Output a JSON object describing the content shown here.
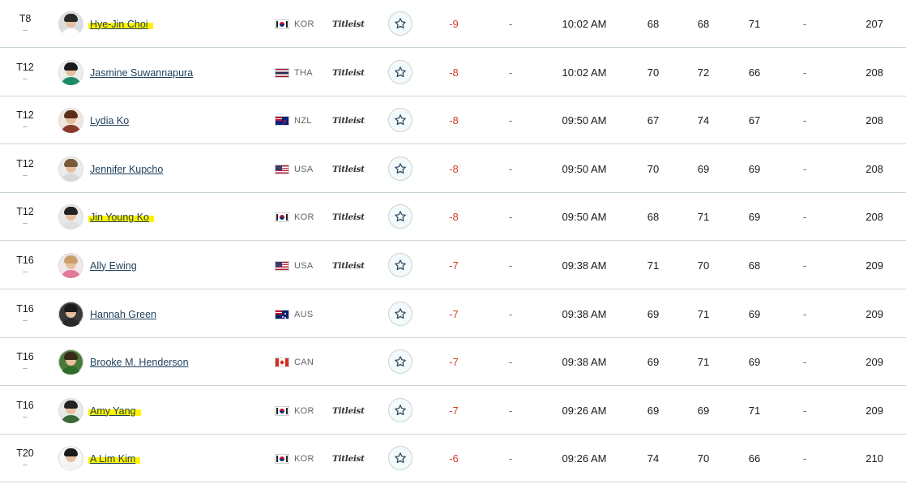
{
  "rows": [
    {
      "pos": "T8",
      "move": "–",
      "name": "Hye-Jin Choi",
      "highlight": true,
      "country": "KOR",
      "sponsor": "Titleist",
      "to_par": "-9",
      "thru": "-",
      "time": "10:02 AM",
      "r1": "68",
      "r2": "68",
      "r3": "71",
      "r4": "-",
      "total": "207",
      "colors": {
        "hair": "#2a2a2a",
        "top": "#ffffff",
        "bg": "#d9dede"
      }
    },
    {
      "pos": "T12",
      "move": "–",
      "name": "Jasmine Suwannapura",
      "highlight": false,
      "country": "THA",
      "sponsor": "Titleist",
      "to_par": "-8",
      "thru": "-",
      "time": "10:02 AM",
      "r1": "70",
      "r2": "72",
      "r3": "66",
      "r4": "-",
      "total": "208",
      "colors": {
        "hair": "#1a1a1a",
        "top": "#1f8a6a",
        "bg": "#e9f0ee"
      }
    },
    {
      "pos": "T12",
      "move": "–",
      "name": "Lydia Ko",
      "highlight": false,
      "country": "NZL",
      "sponsor": "Titleist",
      "to_par": "-8",
      "thru": "-",
      "time": "09:50 AM",
      "r1": "67",
      "r2": "74",
      "r3": "67",
      "r4": "-",
      "total": "208",
      "colors": {
        "hair": "#5a2e1a",
        "top": "#8a3a2a",
        "bg": "#f1e6e0"
      }
    },
    {
      "pos": "T12",
      "move": "–",
      "name": "Jennifer Kupcho",
      "highlight": false,
      "country": "USA",
      "sponsor": "Titleist",
      "to_par": "-8",
      "thru": "-",
      "time": "09:50 AM",
      "r1": "70",
      "r2": "69",
      "r3": "69",
      "r4": "-",
      "total": "208",
      "colors": {
        "hair": "#7a5a3a",
        "top": "#d8d8d8",
        "bg": "#ececec"
      }
    },
    {
      "pos": "T12",
      "move": "–",
      "name": "Jin Young Ko",
      "highlight": true,
      "country": "KOR",
      "sponsor": "Titleist",
      "to_par": "-8",
      "thru": "-",
      "time": "09:50 AM",
      "r1": "68",
      "r2": "71",
      "r3": "69",
      "r4": "-",
      "total": "208",
      "colors": {
        "hair": "#222222",
        "top": "#e0e0e0",
        "bg": "#e9e9e9"
      }
    },
    {
      "pos": "T16",
      "move": "–",
      "name": "Ally Ewing",
      "highlight": false,
      "country": "USA",
      "sponsor": "Titleist",
      "to_par": "-7",
      "thru": "-",
      "time": "09:38 AM",
      "r1": "71",
      "r2": "70",
      "r3": "68",
      "r4": "-",
      "total": "209",
      "colors": {
        "hair": "#c9a06a",
        "top": "#e27a9a",
        "bg": "#f0e8ec"
      }
    },
    {
      "pos": "T16",
      "move": "–",
      "name": "Hannah Green",
      "highlight": false,
      "country": "AUS",
      "sponsor": "",
      "to_par": "-7",
      "thru": "-",
      "time": "09:38 AM",
      "r1": "69",
      "r2": "71",
      "r3": "69",
      "r4": "-",
      "total": "209",
      "colors": {
        "hair": "#1a1a1a",
        "top": "#2a2a2a",
        "bg": "#3a3a3a"
      }
    },
    {
      "pos": "T16",
      "move": "–",
      "name": "Brooke M. Henderson",
      "highlight": false,
      "country": "CAN",
      "sponsor": "",
      "to_par": "-7",
      "thru": "-",
      "time": "09:38 AM",
      "r1": "69",
      "r2": "71",
      "r3": "69",
      "r4": "-",
      "total": "209",
      "colors": {
        "hair": "#3a2a1a",
        "top": "#2f6b2a",
        "bg": "#4a7a3a"
      }
    },
    {
      "pos": "T16",
      "move": "–",
      "name": "Amy Yang",
      "highlight": true,
      "country": "KOR",
      "sponsor": "Titleist",
      "to_par": "-7",
      "thru": "-",
      "time": "09:26 AM",
      "r1": "69",
      "r2": "69",
      "r3": "71",
      "r4": "-",
      "total": "209",
      "colors": {
        "hair": "#222222",
        "top": "#3a6a3a",
        "bg": "#e4ebe4"
      }
    },
    {
      "pos": "T20",
      "move": "–",
      "name": "A Lim Kim",
      "highlight": true,
      "country": "KOR",
      "sponsor": "Titleist",
      "to_par": "-6",
      "thru": "-",
      "time": "09:26 AM",
      "r1": "74",
      "r2": "70",
      "r3": "66",
      "r4": "-",
      "total": "210",
      "colors": {
        "hair": "#1a1a1a",
        "top": "#f2f2f2",
        "bg": "#f6f6f6"
      }
    }
  ],
  "favorite_icon": "star-icon",
  "colors": {
    "to_par_negative": "#d0402b",
    "link": "#1f3f5b",
    "divider": "#c9d6d8",
    "highlight": "#fff200"
  }
}
